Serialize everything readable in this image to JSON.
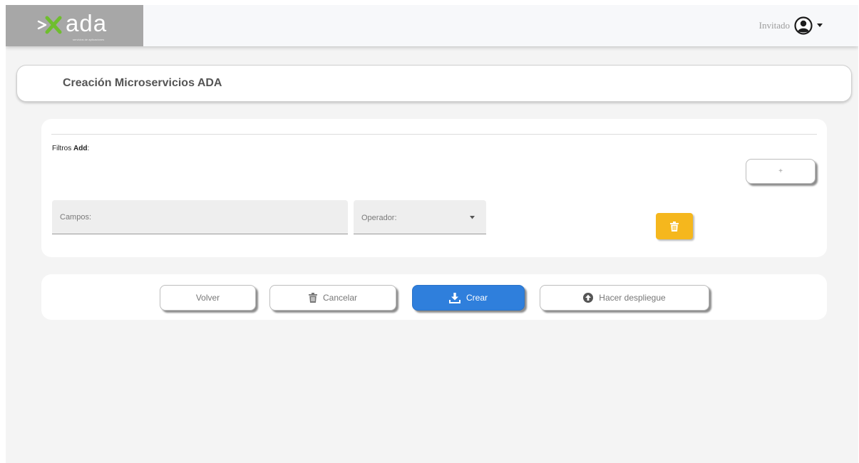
{
  "header": {
    "logo_text": "ada",
    "logo_tagline": "servicios de aplicaciones",
    "user_name": "Invitado",
    "icons": {
      "logo_mark": "ada-arrows-logo",
      "avatar": "user-circle-icon",
      "dropdown": "caret-down-icon"
    }
  },
  "title_card": {
    "title": "Creación Microservicios ADA"
  },
  "filters": {
    "label_prefix": "Filtros",
    "label_strong": "Add",
    "label_suffix": ":",
    "add_button_label": "+",
    "campos_placeholder": "Campos:",
    "campos_value": "",
    "operador_label": "Operador:",
    "delete_icon": "trash-icon",
    "colors": {
      "delete_button": "#f5b71d"
    }
  },
  "actions": {
    "volver": "Volver",
    "cancelar": "Cancelar",
    "crear": "Crear",
    "deploy": "Hacer despliegue",
    "icons": {
      "cancelar": "trash-icon",
      "crear": "download-icon",
      "deploy": "upload-circle-icon"
    },
    "colors": {
      "primary": "#2f7fdc"
    }
  }
}
